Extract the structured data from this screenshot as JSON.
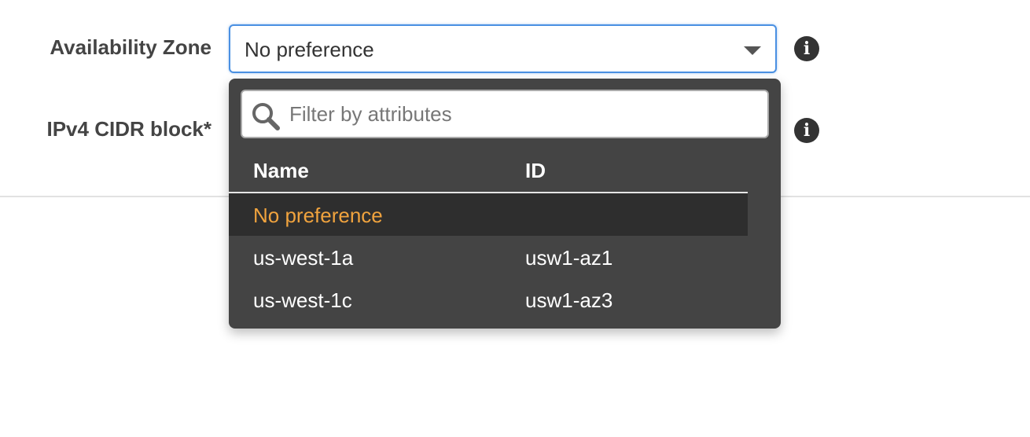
{
  "form": {
    "availability_zone": {
      "label": "Availability Zone",
      "selected_value": "No preference"
    },
    "cidr_block": {
      "label": "IPv4 CIDR block*"
    },
    "info_icon": "i"
  },
  "dropdown": {
    "filter_placeholder": "Filter by attributes",
    "columns": {
      "name": "Name",
      "id": "ID"
    },
    "options": [
      {
        "name": "No preference",
        "id": ""
      },
      {
        "name": "us-west-1a",
        "id": "usw1-az1"
      },
      {
        "name": "us-west-1c",
        "id": "usw1-az3"
      }
    ],
    "selected_index": 0
  },
  "colors": {
    "accent_focus": "#4a90e2",
    "selected_text": "#f0a33e",
    "dropdown_bg": "#444444"
  },
  "icons": {
    "info": "info-icon",
    "search": "search-icon",
    "caret": "caret-down-icon"
  }
}
